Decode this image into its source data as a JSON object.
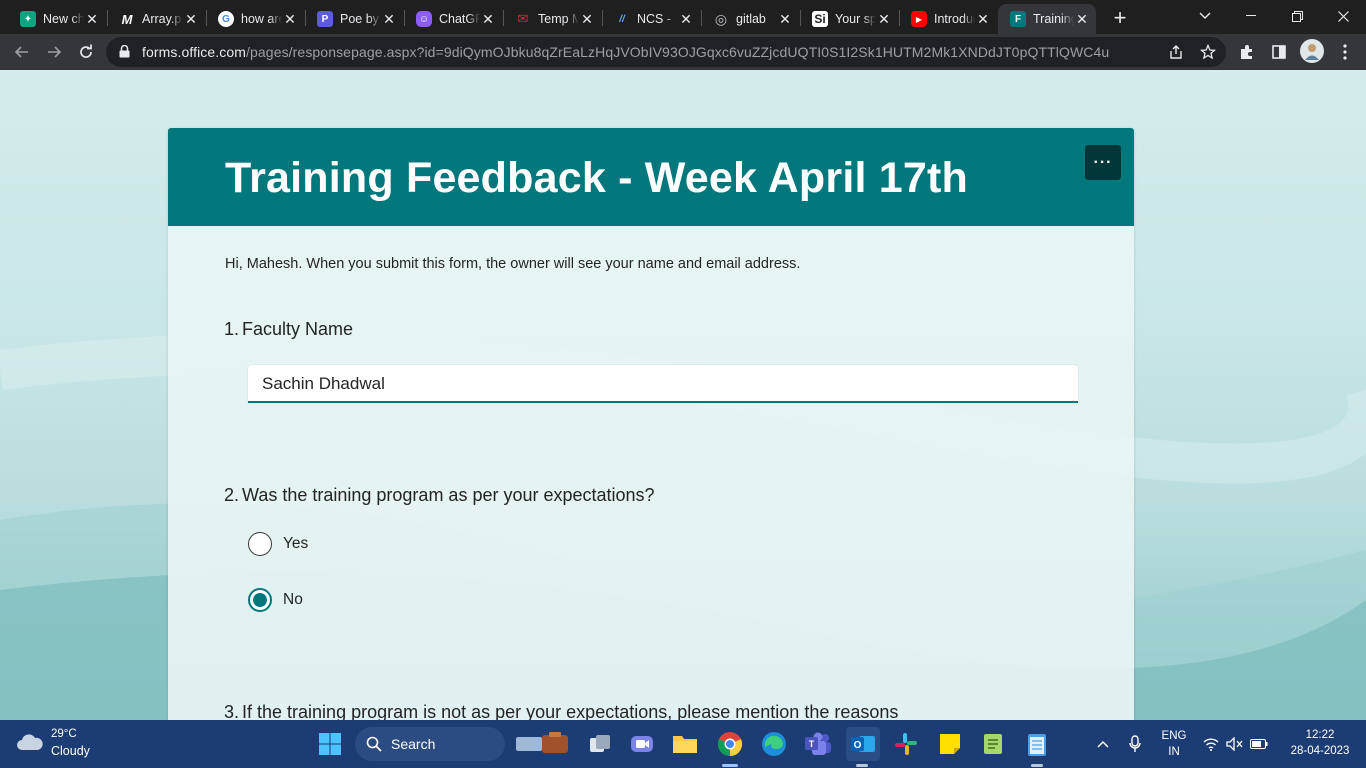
{
  "browser": {
    "tabs": [
      {
        "title": "New chat",
        "icon": "chatgpt-icon",
        "color": "#10a37f",
        "glyph": "✦"
      },
      {
        "title": "Array.prototype",
        "icon": "mdn-icon",
        "color": "#1f1f1f",
        "glyph": "M"
      },
      {
        "title": "how are",
        "icon": "google-icon",
        "color": "#ffffff",
        "glyph": "G"
      },
      {
        "title": "Poe by Quora",
        "icon": "poe-icon",
        "color": "#5d5cde",
        "glyph": "P"
      },
      {
        "title": "ChatGPT",
        "icon": "chatgpt-purple-icon",
        "color": "#8b5cf6",
        "glyph": "☺"
      },
      {
        "title": "Temp Mail",
        "icon": "mail-icon",
        "color": "#d93025",
        "glyph": "✉"
      },
      {
        "title": "NCS - ",
        "icon": "ncs-icon",
        "color": "#1f1f1f",
        "glyph": "//"
      },
      {
        "title": "gitlab",
        "icon": "globe-icon",
        "color": "#9aa0a6",
        "glyph": "◎"
      },
      {
        "title": "Your space",
        "icon": "si-icon",
        "color": "#1f1f1f",
        "glyph": "S"
      },
      {
        "title": "Introduction",
        "icon": "youtube-icon",
        "color": "#ff0000",
        "glyph": "▶"
      },
      {
        "title": "Training",
        "icon": "forms-icon",
        "color": "#03787c",
        "glyph": "F"
      }
    ],
    "url_host": "forms.office.com",
    "url_path": "/pages/responsepage.aspx?id=9diQymOJbku8qZrEaLzHqJVObIV93OJGqxc6vuZZjcdUQTI0S1I2Sk1HUTM2Mk1XNDdJT0pQTTlQWC4u"
  },
  "form": {
    "title": "Training Feedback - Week April 17th",
    "more_label": "···",
    "notice": "Hi, Mahesh. When you submit this form, the owner will see your name and email address.",
    "questions": [
      {
        "num": "1.",
        "text": "Faculty Name",
        "answer": "Sachin Dhadwal"
      },
      {
        "num": "2.",
        "text": "Was the training program as per your expectations?",
        "options": [
          "Yes",
          "No"
        ],
        "selected": "No"
      },
      {
        "num": "3.",
        "text": "If the training program is not as per your expectations, please mention the reasons"
      }
    ]
  },
  "taskbar": {
    "weather_temp": "29°C",
    "weather_cond": "Cloudy",
    "search_label": "Search",
    "lang_top": "ENG",
    "lang_bottom": "IN",
    "time": "12:22",
    "date": "28-04-2023"
  },
  "colors": {
    "accent": "#03787c",
    "taskbar": "#1c3c73"
  }
}
